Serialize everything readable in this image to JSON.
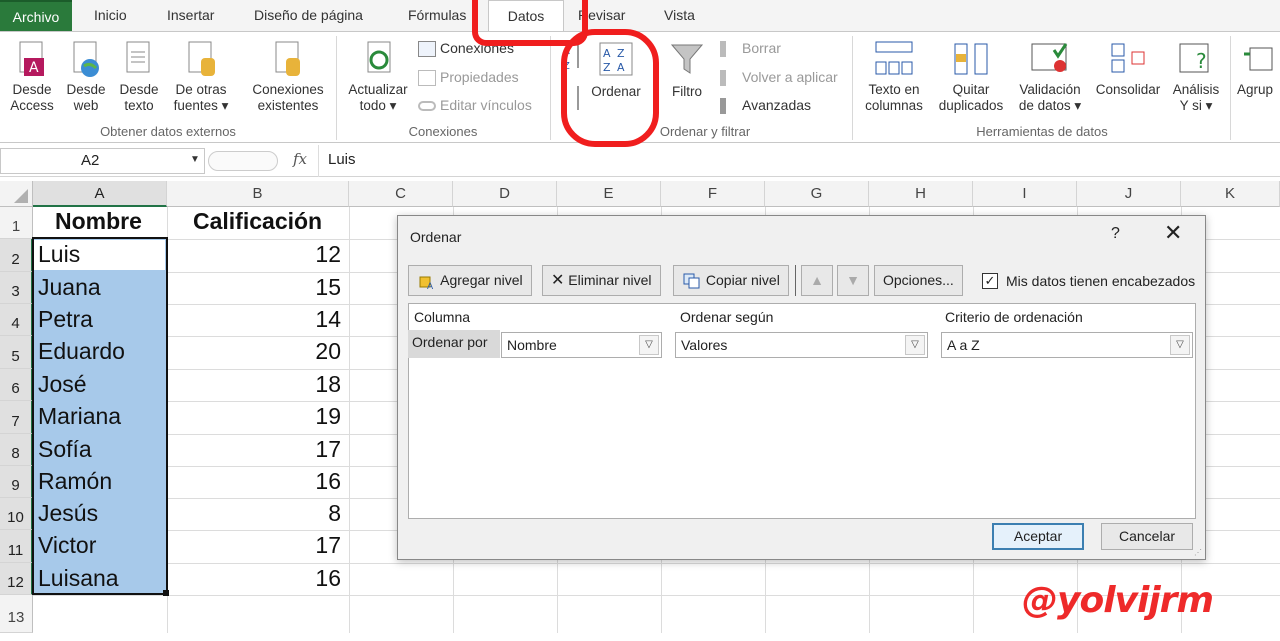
{
  "ribbon_tabs": [
    "Archivo",
    "Inicio",
    "Insertar",
    "Diseño de página",
    "Fórmulas",
    "Datos",
    "Revisar",
    "Vista"
  ],
  "groups": {
    "external": {
      "label": "Obtener datos externos",
      "buttons": [
        {
          "line1": "Desde",
          "line2": "Access"
        },
        {
          "line1": "Desde",
          "line2": "web"
        },
        {
          "line1": "Desde",
          "line2": "texto"
        },
        {
          "line1": "De otras",
          "line2": "fuentes ▾"
        },
        {
          "line1": "Conexiones",
          "line2": "existentes"
        }
      ]
    },
    "connections": {
      "label": "Conexiones",
      "refresh": {
        "line1": "Actualizar",
        "line2": "todo ▾"
      },
      "items": [
        "Conexiones",
        "Propiedades",
        "Editar vínculos"
      ]
    },
    "sort_filter": {
      "label": "Ordenar y filtrar",
      "sort": "Ordenar",
      "filter": "Filtro",
      "items": [
        "Borrar",
        "Volver a aplicar",
        "Avanzadas"
      ]
    },
    "data_tools": {
      "label": "Herramientas de datos",
      "buttons": [
        {
          "line1": "Texto en",
          "line2": "columnas"
        },
        {
          "line1": "Quitar",
          "line2": "duplicados"
        },
        {
          "line1": "Validación",
          "line2": "de datos ▾"
        },
        {
          "line1": "Consolidar",
          "line2": ""
        },
        {
          "line1": "Análisis",
          "line2": "Y si ▾"
        }
      ]
    },
    "outline": {
      "first": "Agrup"
    }
  },
  "formula_bar": {
    "name_box": "A2",
    "fx": "fx",
    "value": "Luis"
  },
  "columns": [
    "A",
    "B",
    "C",
    "D",
    "E",
    "F",
    "G",
    "H",
    "I",
    "J",
    "K"
  ],
  "rows": [
    "1",
    "2",
    "3",
    "4",
    "5",
    "6",
    "7",
    "8",
    "9",
    "10",
    "11",
    "12",
    "13"
  ],
  "table": {
    "headers": [
      "Nombre",
      "Calificación"
    ],
    "names": [
      "Luis",
      "Juana",
      "Petra",
      "Eduardo",
      "José",
      "Mariana",
      "Sofía",
      "Ramón",
      "Jesús",
      "Victor",
      "Luisana"
    ],
    "scores": [
      "12",
      "15",
      "14",
      "20",
      "18",
      "19",
      "17",
      "16",
      "8",
      "17",
      "16"
    ]
  },
  "dialog": {
    "title": "Ordenar",
    "help": "?",
    "close": "✕",
    "add_level": "Agregar nivel",
    "delete_level": "Eliminar nivel",
    "copy_level": "Copiar nivel",
    "options": "Opciones...",
    "has_headers_label": "Mis datos tienen encabezados",
    "has_headers_checked": true,
    "col_header_column": "Columna",
    "col_header_sort_on": "Ordenar según",
    "col_header_order": "Criterio de ordenación",
    "row_label": "Ordenar por",
    "sort_by_value": "Nombre",
    "sort_on_value": "Valores",
    "order_value": "A a Z",
    "ok": "Aceptar",
    "cancel": "Cancelar"
  },
  "watermark": "@yolvijrm",
  "colors": {
    "accent_red": "#f01e1e",
    "selection": "#a7c9ea",
    "excel_green": "#217346"
  }
}
